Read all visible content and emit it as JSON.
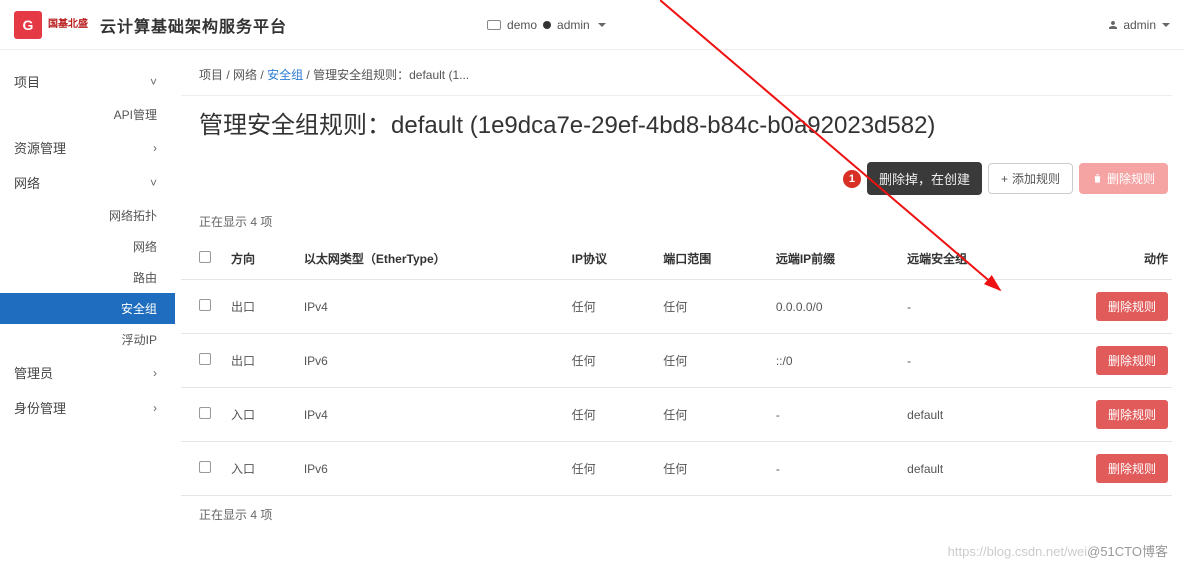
{
  "topbar": {
    "brand_small": "国基北盛",
    "logo_glyph": "G",
    "platform_name": "云计算基础架构服务平台",
    "project_label": "demo",
    "user_label": "admin",
    "right_user": "admin"
  },
  "sidebar": {
    "items": [
      {
        "label": "项目",
        "chevron": "˅",
        "subs": [
          {
            "label": "API管理"
          }
        ]
      },
      {
        "label": "资源管理",
        "chevron": "›"
      },
      {
        "label": "网络",
        "chevron": "˅",
        "subs": [
          {
            "label": "网络拓扑"
          },
          {
            "label": "网络"
          },
          {
            "label": "路由"
          },
          {
            "label": "安全组",
            "active": true
          },
          {
            "label": "浮动IP"
          }
        ]
      },
      {
        "label": "管理员",
        "chevron": "›"
      },
      {
        "label": "身份管理",
        "chevron": "›"
      }
    ]
  },
  "breadcrumb": {
    "parts": [
      "项目",
      "网络",
      "安全组",
      "管理安全组规则：default (1..."
    ],
    "sep": " / "
  },
  "page_title": "管理安全组规则：default (1e9dca7e-29ef-4bd8-b84c-b0a92023d582)",
  "toolbar": {
    "annot_num": "1",
    "annot_text": "删除掉，在创建",
    "add_rule": "添加规则",
    "delete_rule": "删除规则"
  },
  "count_text_top": "正在显示 4 项",
  "count_text_bottom": "正在显示 4 项",
  "table": {
    "headers": [
      "方向",
      "以太网类型（EtherType）",
      "IP协议",
      "端口范围",
      "远端IP前缀",
      "远端安全组",
      "动作"
    ],
    "rows": [
      {
        "dir": "出口",
        "ether": "IPv4",
        "proto": "任何",
        "port": "任何",
        "prefix": "0.0.0.0/0",
        "group": "-"
      },
      {
        "dir": "出口",
        "ether": "IPv6",
        "proto": "任何",
        "port": "任何",
        "prefix": "::/0",
        "group": "-"
      },
      {
        "dir": "入口",
        "ether": "IPv4",
        "proto": "任何",
        "port": "任何",
        "prefix": "-",
        "group": "default"
      },
      {
        "dir": "入口",
        "ether": "IPv6",
        "proto": "任何",
        "port": "任何",
        "prefix": "-",
        "group": "default"
      }
    ],
    "row_action": "删除规则"
  },
  "watermark": {
    "faint": "https://blog.csdn.net/wei",
    "strong": "@51CTO博客"
  }
}
